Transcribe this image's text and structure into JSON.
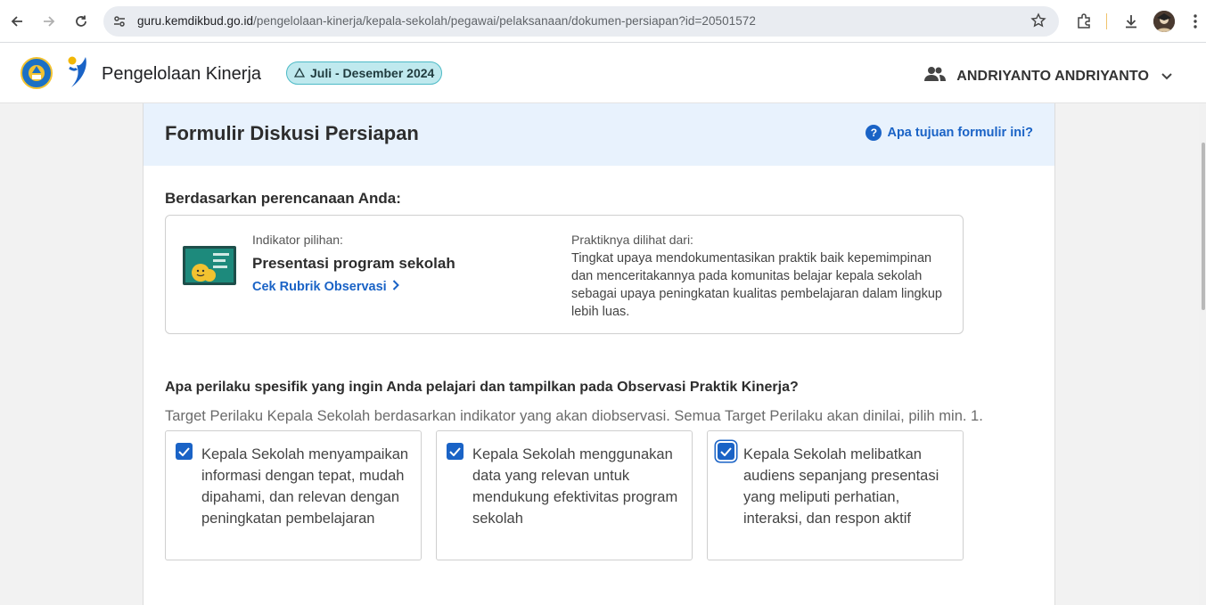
{
  "browser": {
    "url_host": "guru.kemdikbud.go.id",
    "url_path": "/pengelolaan-kinerja/kepala-sekolah/pegawai/pelaksanaan/dokumen-persiapan?id=20501572"
  },
  "header": {
    "app_title": "Pengelolaan Kinerja",
    "period": "Juli - Desember 2024",
    "user_name": "ANDRIYANTO ANDRIYANTO"
  },
  "form": {
    "title": "Formulir Diskusi Persiapan",
    "help_link": "Apa tujuan formulir ini?",
    "section_heading": "Berdasarkan perencanaan Anda:",
    "indicator_label": "Indikator pilihan:",
    "indicator_value": "Presentasi program sekolah",
    "rubrik_link": "Cek Rubrik Observasi",
    "practice_label": "Praktiknya dilihat dari:",
    "practice_text": "Tingkat upaya mendokumentasikan praktik baik kepemimpinan dan menceritakannya pada komunitas belajar kepala sekolah sebagai upaya peningkatan kualitas pembelajaran dalam lingkup lebih luas.",
    "question": "Apa perilaku spesifik yang ingin Anda pelajari dan tampilkan pada Observasi Praktik Kinerja?",
    "subtext": "Target Perilaku Kepala Sekolah berdasarkan indikator yang akan diobservasi. Semua Target Perilaku akan dinilai, pilih min. 1.",
    "options": [
      {
        "text": "Kepala Sekolah menyampaikan informasi dengan tepat, mudah dipahami, dan relevan dengan peningkatan pembelajaran",
        "checked": true
      },
      {
        "text": "Kepala Sekolah menggunakan data yang relevan untuk mendukung efektivitas program sekolah",
        "checked": true
      },
      {
        "text": "Kepala Sekolah melibatkan audiens sepanjang presentasi yang meliputi perhatian, interaksi, dan respon aktif",
        "checked": true
      }
    ]
  },
  "colors": {
    "accent": "#1a63c6",
    "header_bg": "#e8f2fd",
    "period_bg": "#bfe9ee"
  }
}
